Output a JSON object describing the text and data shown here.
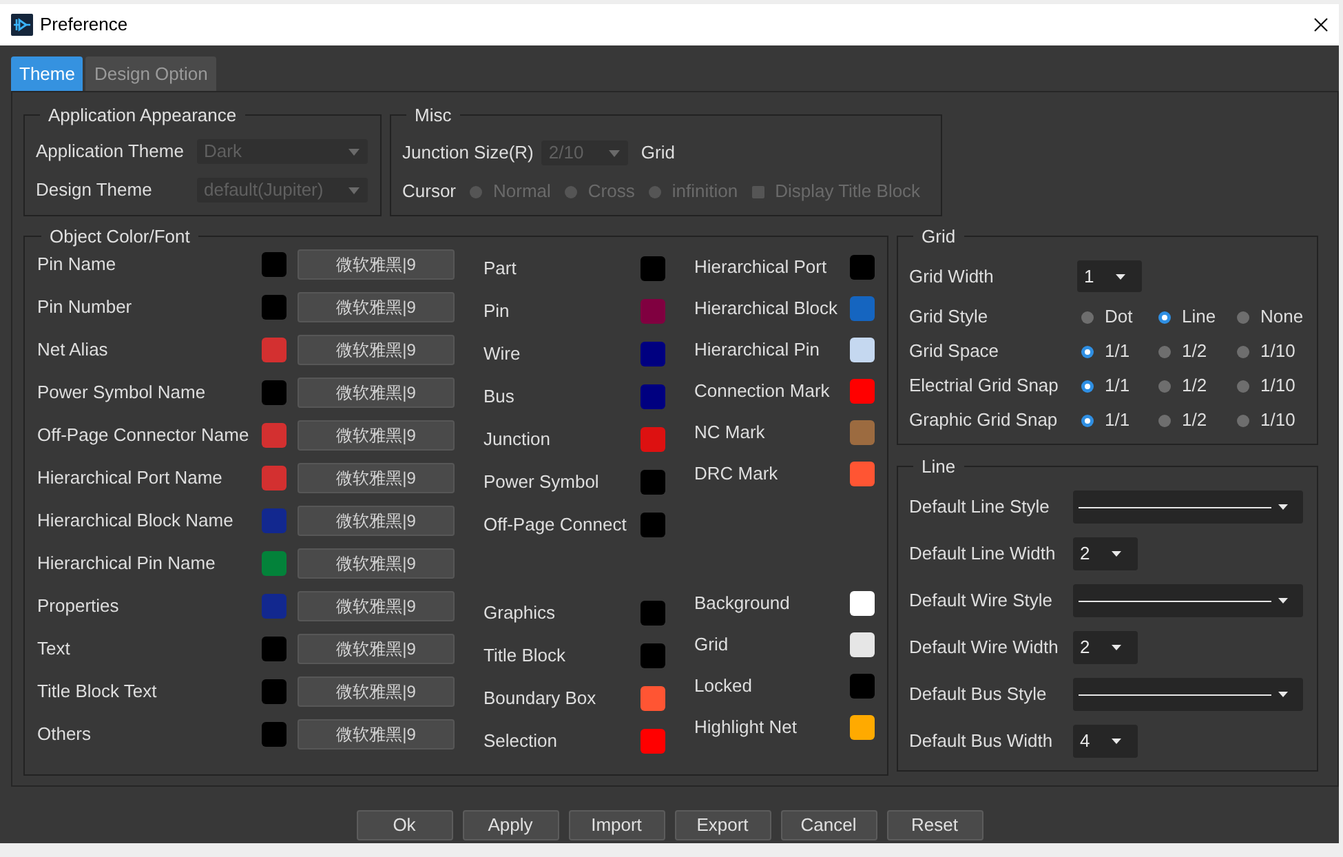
{
  "window": {
    "title": "Preference"
  },
  "tabs": [
    {
      "label": "Theme",
      "selected": true
    },
    {
      "label": "Design Option",
      "selected": false
    }
  ],
  "application_appearance": {
    "title": "Application Appearance",
    "fields": [
      {
        "label": "Application Theme",
        "value": "Dark",
        "disabled": true
      },
      {
        "label": "Design Theme",
        "value": "default(Jupiter)",
        "disabled": true
      }
    ]
  },
  "misc": {
    "title": "Misc",
    "junction_size": {
      "label": "Junction Size(R)",
      "value": "2/10",
      "disabled": true
    },
    "unit": "Grid",
    "cursor": {
      "label": "Cursor",
      "options": [
        {
          "label": "Normal",
          "selected": false,
          "disabled": true
        },
        {
          "label": "Cross",
          "selected": false,
          "disabled": true
        },
        {
          "label": "infinition",
          "selected": false,
          "disabled": true
        }
      ]
    },
    "display_title_block": {
      "label": "Display Title Block",
      "checked": false,
      "disabled": true
    }
  },
  "object_color_font": {
    "title": "Object Color/Font",
    "font_items": [
      {
        "label": "Pin Name",
        "color": "#000000",
        "font": "微软雅黑|9"
      },
      {
        "label": "Pin Number",
        "color": "#000000",
        "font": "微软雅黑|9"
      },
      {
        "label": "Net Alias",
        "color": "#d33030",
        "font": "微软雅黑|9"
      },
      {
        "label": "Power Symbol Name",
        "color": "#000000",
        "font": "微软雅黑|9"
      },
      {
        "label": "Off-Page Connector Name",
        "color": "#d33030",
        "font": "微软雅黑|9"
      },
      {
        "label": "Hierarchical Port Name",
        "color": "#d33030",
        "font": "微软雅黑|9"
      },
      {
        "label": "Hierarchical Block Name",
        "color": "#12288f",
        "font": "微软雅黑|9"
      },
      {
        "label": "Hierarchical Pin Name",
        "color": "#03823a",
        "font": "微软雅黑|9"
      },
      {
        "label": "Properties",
        "color": "#12288f",
        "font": "微软雅黑|9"
      },
      {
        "label": "Text",
        "color": "#000000",
        "font": "微软雅黑|9"
      },
      {
        "label": "Title Block Text",
        "color": "#000000",
        "font": "微软雅黑|9"
      },
      {
        "label": "Others",
        "color": "#000000",
        "font": "微软雅黑|9"
      }
    ],
    "color_columns": [
      {
        "groups": [
          {
            "items": [
              {
                "label": "Part",
                "color": "#000000"
              },
              {
                "label": "Pin",
                "color": "#800040"
              },
              {
                "label": "Wire",
                "color": "#000080"
              },
              {
                "label": "Bus",
                "color": "#000080"
              },
              {
                "label": "Junction",
                "color": "#dd1111"
              },
              {
                "label": "Power Symbol",
                "color": "#000000"
              },
              {
                "label": "Off-Page Connect",
                "color": "#000000"
              }
            ]
          },
          {
            "items": [
              {
                "label": "Graphics",
                "color": "#000000"
              },
              {
                "label": "Title Block",
                "color": "#000000"
              },
              {
                "label": "Boundary Box",
                "color": "#ff5533"
              },
              {
                "label": "Selection",
                "color": "#ff0000"
              }
            ]
          }
        ]
      },
      {
        "groups": [
          {
            "items": [
              {
                "label": "Hierarchical Port",
                "color": "#000000"
              },
              {
                "label": "Hierarchical Block",
                "color": "#1565c0"
              },
              {
                "label": "Hierarchical Pin",
                "color": "#c5d8f0"
              },
              {
                "label": "Connection Mark",
                "color": "#ff0000"
              },
              {
                "label": "NC Mark",
                "color": "#9c6b40"
              },
              {
                "label": "DRC Mark",
                "color": "#ff5533"
              }
            ]
          },
          {
            "items": [
              {
                "label": "Background",
                "color": "#ffffff"
              },
              {
                "label": "Grid",
                "color": "#e6e6e6"
              },
              {
                "label": "Locked",
                "color": "#000000"
              },
              {
                "label": "Highlight Net",
                "color": "#ffaa00"
              }
            ]
          }
        ]
      }
    ]
  },
  "grid": {
    "title": "Grid",
    "rows": [
      {
        "kind": "select",
        "label": "Grid Width",
        "value": "1"
      },
      {
        "kind": "radio",
        "label": "Grid Style",
        "options": [
          {
            "label": "Dot",
            "selected": false
          },
          {
            "label": "Line",
            "selected": true
          },
          {
            "label": "None",
            "selected": false
          }
        ]
      },
      {
        "kind": "radio",
        "label": "Grid Space",
        "options": [
          {
            "label": "1/1",
            "selected": true
          },
          {
            "label": "1/2",
            "selected": false
          },
          {
            "label": "1/10",
            "selected": false
          }
        ]
      },
      {
        "kind": "radio",
        "label": "Electrial Grid Snap",
        "options": [
          {
            "label": "1/1",
            "selected": true
          },
          {
            "label": "1/2",
            "selected": false
          },
          {
            "label": "1/10",
            "selected": false
          }
        ]
      },
      {
        "kind": "radio",
        "label": "Graphic Grid Snap",
        "options": [
          {
            "label": "1/1",
            "selected": true
          },
          {
            "label": "1/2",
            "selected": false
          },
          {
            "label": "1/10",
            "selected": false
          }
        ]
      }
    ]
  },
  "line": {
    "title": "Line",
    "rows": [
      {
        "kind": "style",
        "label": "Default Line Style"
      },
      {
        "kind": "select",
        "label": "Default Line Width",
        "value": "2"
      },
      {
        "kind": "style",
        "label": "Default Wire Style"
      },
      {
        "kind": "select",
        "label": "Default Wire Width",
        "value": "2"
      },
      {
        "kind": "style",
        "label": "Default Bus Style"
      },
      {
        "kind": "select",
        "label": "Default Bus Width",
        "value": "4"
      }
    ]
  },
  "buttons": [
    "Ok",
    "Apply",
    "Import",
    "Export",
    "Cancel",
    "Reset"
  ]
}
